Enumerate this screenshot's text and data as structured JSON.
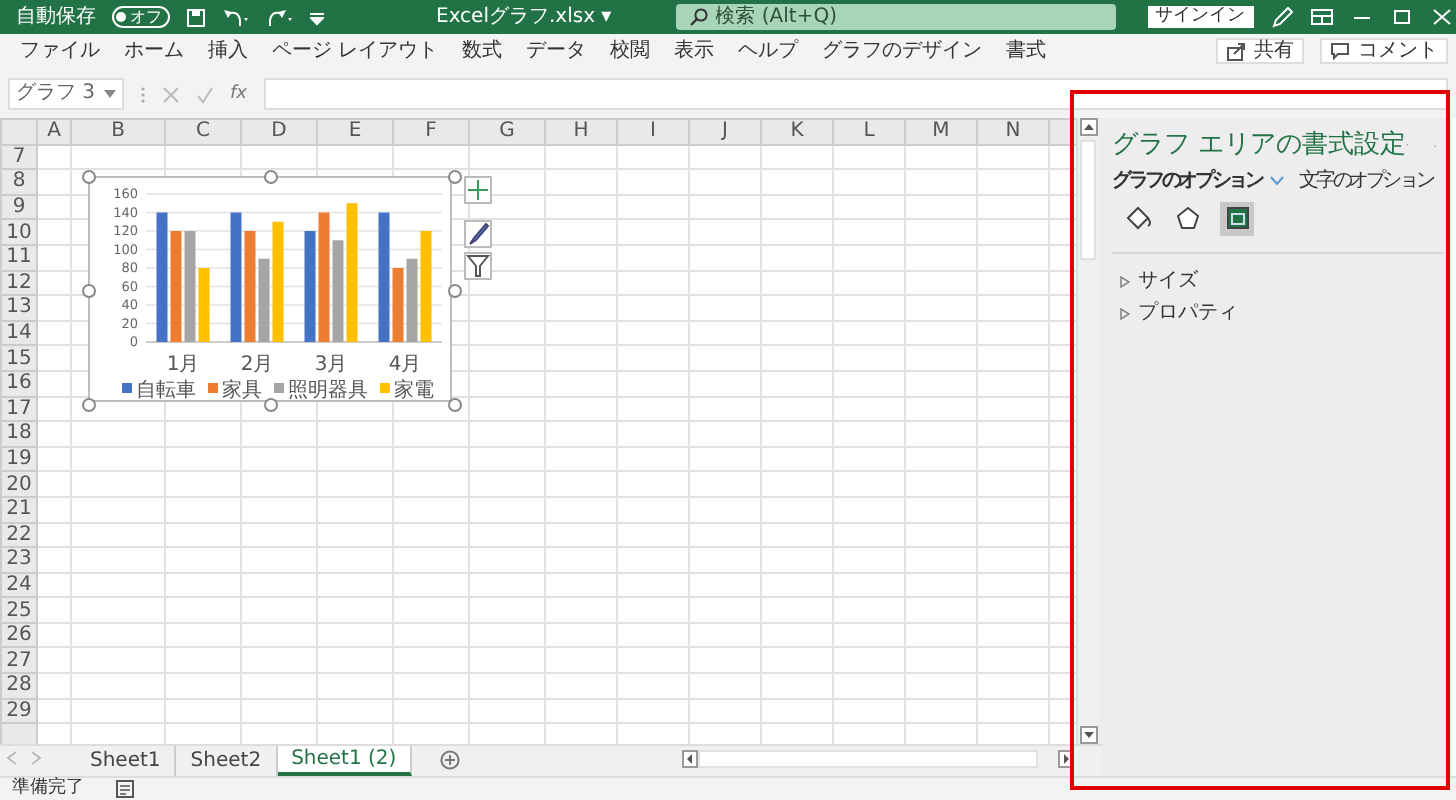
{
  "title_bar": {
    "autosave_label": "自動保存",
    "autosave": {
      "text": "オフ",
      "on": false
    },
    "file_name": "Excelグラフ.xlsx",
    "file_caret": "▾",
    "search": {
      "placeholder": "検索 (Alt+Q)"
    },
    "sign_in": "サインイン"
  },
  "ribbon_tabs": [
    "ファイル",
    "ホーム",
    "挿入",
    "ページ レイアウト",
    "数式",
    "データ",
    "校閲",
    "表示",
    "ヘルプ",
    "グラフのデザイン",
    "書式"
  ],
  "ribbon_actions": [
    "共有",
    "コメント"
  ],
  "formula_bar": {
    "name_box": "グラフ 3",
    "fx": "fx"
  },
  "sheet": {
    "columns": [
      "A",
      "B",
      "C",
      "D",
      "E",
      "F",
      "G",
      "H",
      "I",
      "J",
      "K",
      "L",
      "M",
      "N"
    ],
    "rows": [
      "7",
      "8",
      "9",
      "10",
      "11",
      "12",
      "13",
      "14",
      "15",
      "16",
      "17",
      "18",
      "19",
      "20",
      "21",
      "22",
      "23",
      "24",
      "25",
      "26",
      "27",
      "28",
      "29"
    ]
  },
  "chart": {
    "chart_data": {
      "type": "bar",
      "grid": true,
      "legend": true,
      "categories": [
        "1月",
        "2月",
        "3月",
        "4月"
      ],
      "ylim": [
        0,
        160
      ],
      "yticks": [
        0,
        20,
        40,
        60,
        80,
        100,
        120,
        140,
        160
      ],
      "series": [
        {
          "name": "自転車",
          "color": "#4472c4",
          "values": [
            140,
            140,
            120,
            140
          ]
        },
        {
          "name": "家具",
          "color": "#ed7d31",
          "values": [
            120,
            120,
            140,
            80
          ]
        },
        {
          "name": "照明器具",
          "color": "#a5a5a5",
          "values": [
            120,
            90,
            110,
            90
          ]
        },
        {
          "name": "家電",
          "color": "#ffc000",
          "values": [
            80,
            130,
            150,
            120
          ]
        }
      ]
    }
  },
  "format_panel": {
    "title": "グラフ エリアの書式設定",
    "tabs": [
      {
        "label": "グラフのオプション",
        "selected": true
      },
      {
        "label": "文字のオプション",
        "selected": false
      }
    ],
    "icon_tabs": [
      {
        "kind": "fill",
        "selected": false
      },
      {
        "kind": "effects",
        "selected": false
      },
      {
        "kind": "size",
        "selected": true
      }
    ],
    "sections": [
      {
        "label": "サイズ",
        "expanded": false
      },
      {
        "label": "プロパティ",
        "expanded": false
      }
    ]
  },
  "sheet_tabs": [
    {
      "label": "Sheet1",
      "selected": false
    },
    {
      "label": "Sheet2",
      "selected": false
    },
    {
      "label": "Sheet1 (2)",
      "selected": true
    }
  ],
  "status_bar": {
    "text": "準備完了"
  }
}
